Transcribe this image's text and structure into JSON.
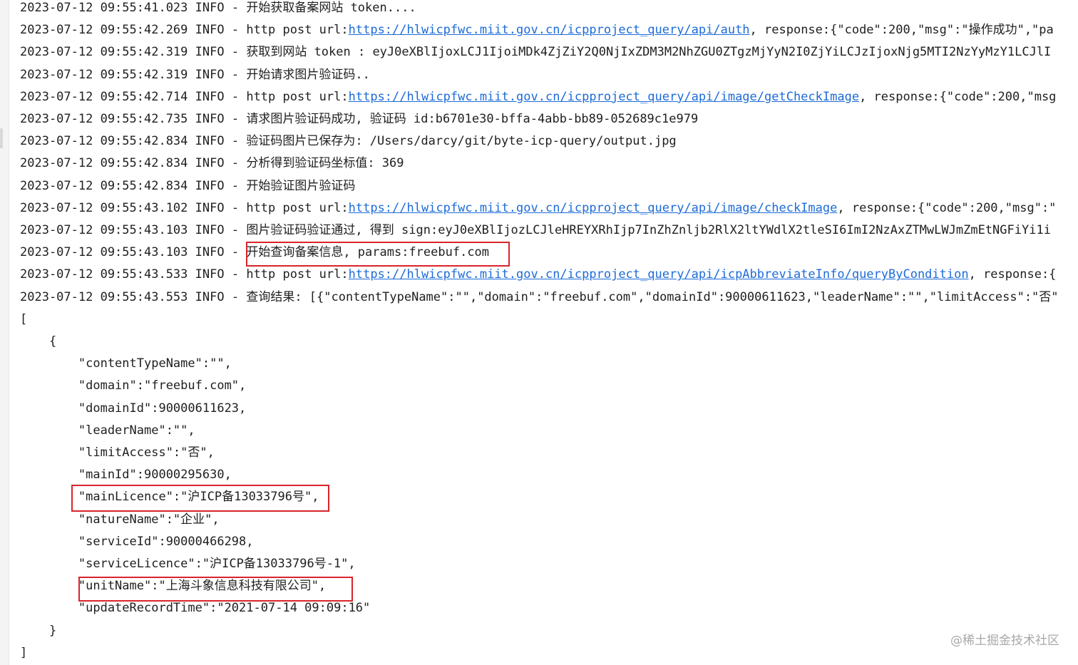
{
  "log": {
    "lines": [
      {
        "ts": "2023-07-12 09:55:41.023",
        "level": "INFO",
        "sep": " - ",
        "pre": "开始获取备案网站 token....",
        "url": "",
        "post": ""
      },
      {
        "ts": "2023-07-12 09:55:42.269",
        "level": "INFO",
        "sep": " - ",
        "pre": "http post url:",
        "url": "https://hlwicpfwc.miit.gov.cn/icpproject_query/api/auth",
        "post": ", response:{\"code\":200,\"msg\":\"操作成功\",\"pa"
      },
      {
        "ts": "2023-07-12 09:55:42.319",
        "level": "INFO",
        "sep": " - ",
        "pre": "获取到网站 token : eyJ0eXBlIjoxLCJ1IjoiMDk4ZjZiY2Q0NjIxZDM3M2NhZGU0ZTgzMjYyN2I0ZjYiLCJzIjoxNjg5MTI2NzYyMzY1LCJlI",
        "url": "",
        "post": ""
      },
      {
        "ts": "2023-07-12 09:55:42.319",
        "level": "INFO",
        "sep": " - ",
        "pre": "开始请求图片验证码..",
        "url": "",
        "post": ""
      },
      {
        "ts": "2023-07-12 09:55:42.714",
        "level": "INFO",
        "sep": " - ",
        "pre": "http post url:",
        "url": "https://hlwicpfwc.miit.gov.cn/icpproject_query/api/image/getCheckImage",
        "post": ", response:{\"code\":200,\"msg"
      },
      {
        "ts": "2023-07-12 09:55:42.735",
        "level": "INFO",
        "sep": " - ",
        "pre": "请求图片验证码成功, 验证码 id:b6701e30-bffa-4abb-bb89-052689c1e979",
        "url": "",
        "post": ""
      },
      {
        "ts": "2023-07-12 09:55:42.834",
        "level": "INFO",
        "sep": " - ",
        "pre": "验证码图片已保存为: /Users/darcy/git/byte-icp-query/output.jpg",
        "url": "",
        "post": ""
      },
      {
        "ts": "2023-07-12 09:55:42.834",
        "level": "INFO",
        "sep": " - ",
        "pre": "分析得到验证码坐标值: 369",
        "url": "",
        "post": ""
      },
      {
        "ts": "2023-07-12 09:55:42.834",
        "level": "INFO",
        "sep": " - ",
        "pre": "开始验证图片验证码",
        "url": "",
        "post": ""
      },
      {
        "ts": "2023-07-12 09:55:43.102",
        "level": "INFO",
        "sep": " - ",
        "pre": "http post url:",
        "url": "https://hlwicpfwc.miit.gov.cn/icpproject_query/api/image/checkImage",
        "post": ", response:{\"code\":200,\"msg\":\""
      },
      {
        "ts": "2023-07-12 09:55:43.103",
        "level": "INFO",
        "sep": " - ",
        "pre": "图片验证码验证通过, 得到 sign:eyJ0eXBlIjozLCJleHREYXRhIjp7InZhZnljb2RlX2ltYWdlX2tleSI6ImI2NzAxZTMwLWJmZmEtNGFiYi1i",
        "url": "",
        "post": ""
      },
      {
        "ts": "2023-07-12 09:55:43.103",
        "level": "INFO",
        "sep": " - ",
        "pre": "开始查询备案信息, params:freebuf.com",
        "url": "",
        "post": ""
      },
      {
        "ts": "2023-07-12 09:55:43.533",
        "level": "INFO",
        "sep": " - ",
        "pre": "http post url:",
        "url": "https://hlwicpfwc.miit.gov.cn/icpproject_query/api/icpAbbreviateInfo/queryByCondition",
        "post": ", response:{"
      },
      {
        "ts": "2023-07-12 09:55:43.553",
        "level": "INFO",
        "sep": " - ",
        "pre": "查询结果: [{\"contentTypeName\":\"\",\"domain\":\"freebuf.com\",\"domainId\":90000611623,\"leaderName\":\"\",\"limitAccess\":\"否\"",
        "url": "",
        "post": ""
      }
    ]
  },
  "json_output": {
    "lines": [
      "[",
      "    {",
      "        \"contentTypeName\":\"\",",
      "        \"domain\":\"freebuf.com\",",
      "        \"domainId\":90000611623,",
      "        \"leaderName\":\"\",",
      "        \"limitAccess\":\"否\",",
      "        \"mainId\":90000295630,",
      "        \"mainLicence\":\"沪ICP备13033796号\",",
      "        \"natureName\":\"企业\",",
      "        \"serviceId\":90000466298,",
      "        \"serviceLicence\":\"沪ICP备13033796号-1\",",
      "        \"unitName\":\"上海斗象信息科技有限公司\",",
      "        \"updateRecordTime\":\"2021-07-14 09:09:16\"",
      "    }",
      "]"
    ]
  },
  "watermark": "@稀土掘金技术社区",
  "colors": {
    "link": "#1c6bd8",
    "highlight_border": "#d9242b",
    "text": "#1f1f1f",
    "watermark": "#a8a8a8"
  }
}
